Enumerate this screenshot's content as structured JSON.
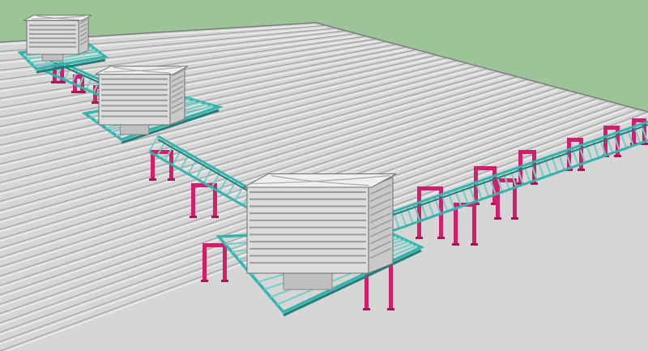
{
  "scene": {
    "colors": {
      "sky": "#9dc498",
      "roof": "#d6d6d6",
      "roof_rib_light": "#f2f2f2",
      "roof_rib_dark": "#9a9a9a",
      "walkway_frame": "#35b3ad",
      "walkway_rung": "#6fd0c8",
      "support": "#cf1f6d",
      "support_foot": "#a91757",
      "cooler_body": "#dcdcdc",
      "cooler_top": "#efefef",
      "cooler_louver": "#9a9a9a",
      "pedestal": "#bfbfbf"
    }
  }
}
